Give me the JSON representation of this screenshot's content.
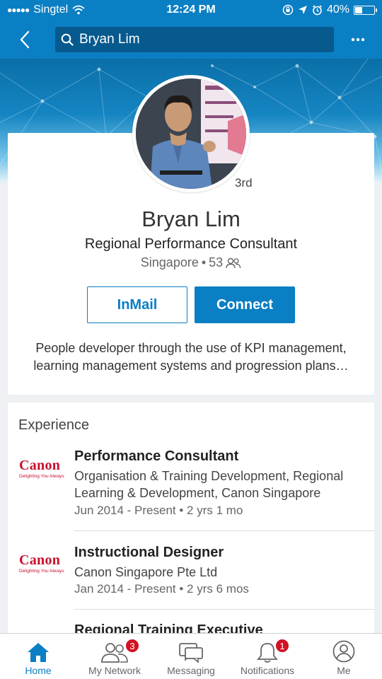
{
  "status_bar": {
    "signal": "●●●●●",
    "carrier": "Singtel",
    "time": "12:24 PM",
    "battery_text": "40%",
    "battery_level": 0.4
  },
  "nav": {
    "search_value": "Bryan Lim"
  },
  "profile": {
    "degree": "3rd",
    "name": "Bryan Lim",
    "headline": "Regional Performance Consultant",
    "location": "Singapore",
    "separator": "•",
    "connections": "53",
    "inmail_label": "InMail",
    "connect_label": "Connect",
    "summary_line1": "People developer through the use of KPI management,",
    "summary_line2": "learning management systems and progression plans…"
  },
  "experience": {
    "title": "Experience",
    "logo_word": "Canon",
    "logo_tagline": "Delighting You Always",
    "items": [
      {
        "role": "Performance Consultant",
        "company_line1": "Organisation & Training Development, Regional",
        "company_line2": "Learning & Development, Canon Singapore",
        "dates": "Jun 2014 - Present • 2 yrs 1 mo"
      },
      {
        "role": "Instructional Designer",
        "company_line1": "Canon Singapore Pte Ltd",
        "dates": "Jan 2014 - Present • 2 yrs 6 mos"
      },
      {
        "role": "Regional Training Executive"
      }
    ]
  },
  "tabs": [
    {
      "label": "Home",
      "active": true,
      "badge": ""
    },
    {
      "label": "My Network",
      "active": false,
      "badge": "3"
    },
    {
      "label": "Messaging",
      "active": false,
      "badge": ""
    },
    {
      "label": "Notifications",
      "active": false,
      "badge": "1"
    },
    {
      "label": "Me",
      "active": false,
      "badge": ""
    }
  ],
  "colors": {
    "brand_blue": "#0b7fc4",
    "badge_red": "#d11124",
    "canon_red": "#c8102e"
  }
}
